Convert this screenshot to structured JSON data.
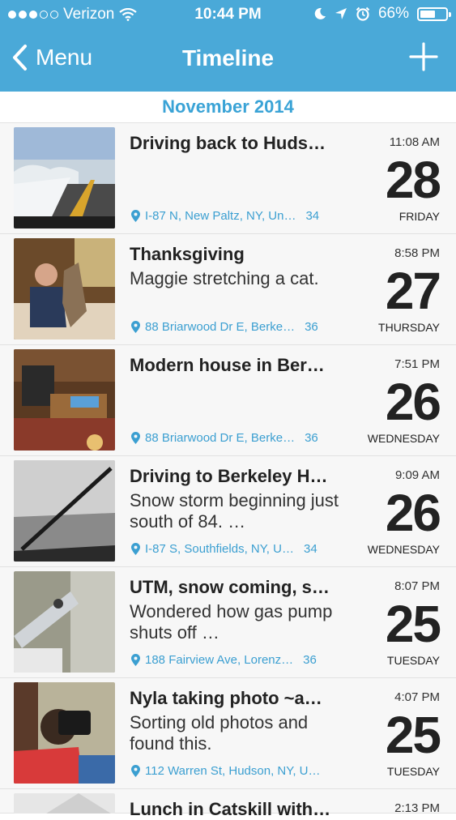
{
  "status": {
    "carrier": "Verizon",
    "time": "10:44 PM",
    "battery": "66%",
    "battery_level": 0.66
  },
  "nav": {
    "back_label": "Menu",
    "title": "Timeline"
  },
  "section": {
    "month": "November 2014"
  },
  "entries": [
    {
      "title": "Driving back to Huds…",
      "note": "",
      "location": "I-87 N, New Paltz, NY, Un…",
      "count": "34",
      "time": "11:08 AM",
      "day": "28",
      "weekday": "FRIDAY"
    },
    {
      "title": "Thanksgiving",
      "note": "Maggie stretching a cat.",
      "location": "88 Briarwood Dr E, Berke…",
      "count": "36",
      "time": "8:58 PM",
      "day": "27",
      "weekday": "THURSDAY"
    },
    {
      "title": "Modern house in Ber…",
      "note": "",
      "location": "88 Briarwood Dr E, Berke…",
      "count": "36",
      "time": "7:51 PM",
      "day": "26",
      "weekday": "WEDNESDAY"
    },
    {
      "title": "Driving to Berkeley H…",
      "note": "Snow storm beginning just south of 84. …",
      "location": "I-87 S, Southfields, NY, U…",
      "count": "34",
      "time": "9:09 AM",
      "day": "26",
      "weekday": "WEDNESDAY"
    },
    {
      "title": "UTM, snow coming, s…",
      "note": "Wondered how gas pump shuts off …",
      "location": "188 Fairview Ave, Lorenz…",
      "count": "36",
      "time": "8:07 PM",
      "day": "25",
      "weekday": "TUESDAY"
    },
    {
      "title": "Nyla taking photo ~a…",
      "note": "Sorting old photos and found this.",
      "location": "112 Warren St, Hudson, NY, U…",
      "count": "",
      "time": "4:07 PM",
      "day": "25",
      "weekday": "TUESDAY"
    }
  ],
  "partial_entry": {
    "title": "Lunch in Catskill with…",
    "time": "2:13 PM"
  }
}
